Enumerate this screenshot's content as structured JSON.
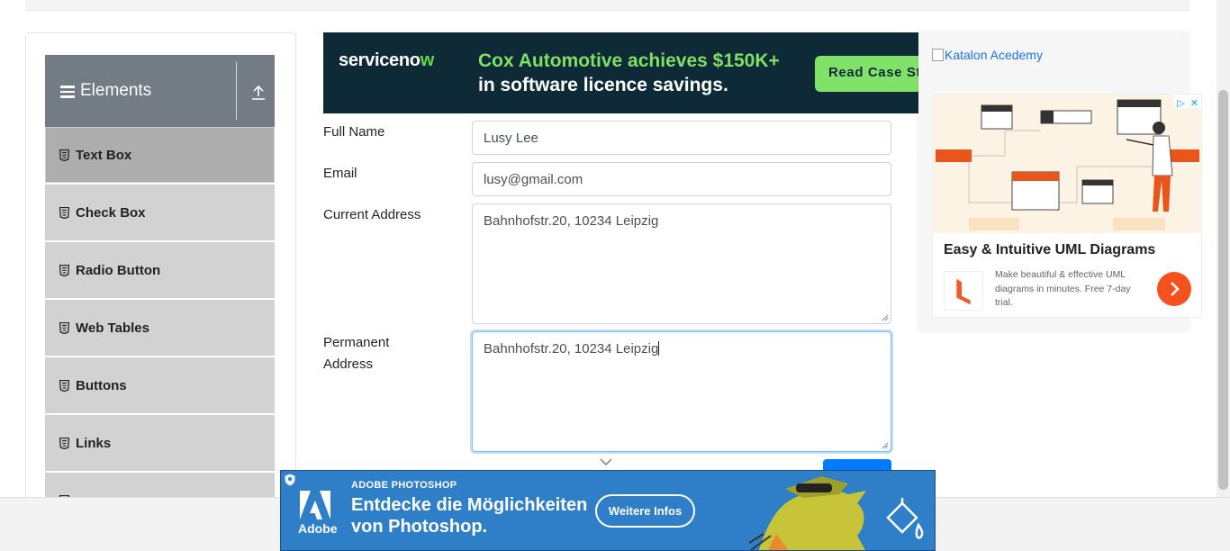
{
  "sidebar": {
    "group_title": "Elements",
    "items": [
      {
        "label": "Text Box"
      },
      {
        "label": "Check Box"
      },
      {
        "label": "Radio Button"
      },
      {
        "label": "Web Tables"
      },
      {
        "label": "Buttons"
      },
      {
        "label": "Links"
      }
    ]
  },
  "top_ad": {
    "logo_main": "serviceno",
    "logo_accent": "w",
    "line1": "Cox Automotive achieves $150K+",
    "line2": "in software licence savings.",
    "cta": "Read Case Study",
    "colors": {
      "background": "#0e2a37",
      "accent": "#7fe063"
    }
  },
  "form": {
    "full_name": {
      "label": "Full Name",
      "value": "Lusy Lee"
    },
    "email": {
      "label": "Email",
      "value": "lusy@gmail.com"
    },
    "current_address": {
      "label": "Current Address",
      "value": "Bahnhofstr.20, 10234 Leipzig"
    },
    "permanent_address": {
      "label_line1": "Permanent",
      "label_line2": "Address",
      "value": "Bahnhofstr.20, 10234 Leipzig"
    }
  },
  "right_ad": {
    "image_alt": "Katalon Acedemy",
    "adchoices": [
      "▷",
      "✕"
    ],
    "title": "Easy & Intuitive UML Diagrams",
    "description": "Make beautiful & effective UML diagrams in minutes. Free 7-day trial."
  },
  "bottom_ad": {
    "eyebrow": "ADOBE PHOTOSHOP",
    "headline_line1": "Entdecke die Möglichkeiten",
    "headline_line2": "von Photoshop.",
    "cta": "Weitere Infos",
    "brand": "Adobe",
    "colors": {
      "background": "#2f7fc8"
    }
  }
}
